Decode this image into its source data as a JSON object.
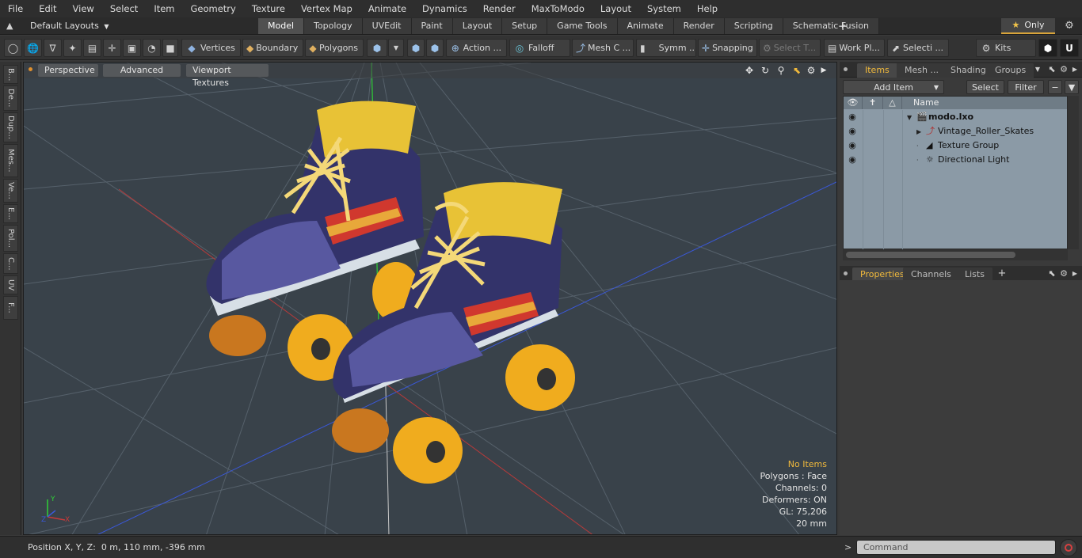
{
  "menubar": [
    "File",
    "Edit",
    "View",
    "Select",
    "Item",
    "Geometry",
    "Texture",
    "Vertex Map",
    "Animate",
    "Dynamics",
    "Render",
    "MaxToModo",
    "Layout",
    "System",
    "Help"
  ],
  "layout": {
    "current": "Default Layouts",
    "tabs": [
      "Model",
      "Topology",
      "UVEdit",
      "Paint",
      "Layout",
      "Setup",
      "Game Tools",
      "Animate",
      "Render",
      "Scripting",
      "Schematic Fusion"
    ],
    "active_tab": "Model",
    "only_label": "Only"
  },
  "toolbar": {
    "vertices": "Vertices",
    "boundary": "Boundary",
    "polygons": "Polygons",
    "action": "Action ...",
    "falloff": "Falloff",
    "mesh": "Mesh C ...",
    "symm": "Symm ...",
    "snapping": "Snapping",
    "select_t": "Select T...",
    "work_pl": "Work Pl...",
    "selecti": "Selecti ...",
    "kits": "Kits"
  },
  "left_tabs": [
    "B...",
    "De...",
    "Dup...",
    "Mes...",
    "Ve...",
    "E...",
    "Pol...",
    "C...",
    "UV",
    "F..."
  ],
  "viewport": {
    "view_mode": "Perspective",
    "shading": "Advanced",
    "textures": "Viewport Textures",
    "stats": {
      "no_items": "No Items",
      "polygons": "Polygons : Face",
      "channels": "Channels: 0",
      "deformers": "Deformers: ON",
      "gl": "GL: 75,206",
      "scale": "20 mm"
    },
    "axis": {
      "x": "X",
      "y": "Y",
      "z": "Z"
    }
  },
  "items_panel": {
    "tabs": [
      "Items",
      "Mesh ...",
      "Shading",
      "Groups"
    ],
    "active_tab": "Items",
    "add_item": "Add Item",
    "select": "Select",
    "filter": "Filter",
    "column_name": "Name",
    "rows": [
      {
        "name": "modo.lxo",
        "icon": "scene-icon"
      },
      {
        "name": "Vintage_Roller_Skates",
        "icon": "mesh-locator-icon"
      },
      {
        "name": "Texture Group",
        "icon": "texture-group-icon"
      },
      {
        "name": "Directional Light",
        "icon": "light-icon"
      }
    ]
  },
  "properties_panel": {
    "tabs": [
      "Properties",
      "Channels",
      "Lists"
    ],
    "active_tab": "Properties"
  },
  "status": {
    "position_label": "Position X, Y, Z:",
    "position_value": "0 m, 110 mm, -396 mm",
    "command_placeholder": "Command"
  },
  "colors": {
    "accent": "#f0b93c",
    "viewport_bg": "#39424a",
    "item_list_bg": "#8b9aa6"
  }
}
